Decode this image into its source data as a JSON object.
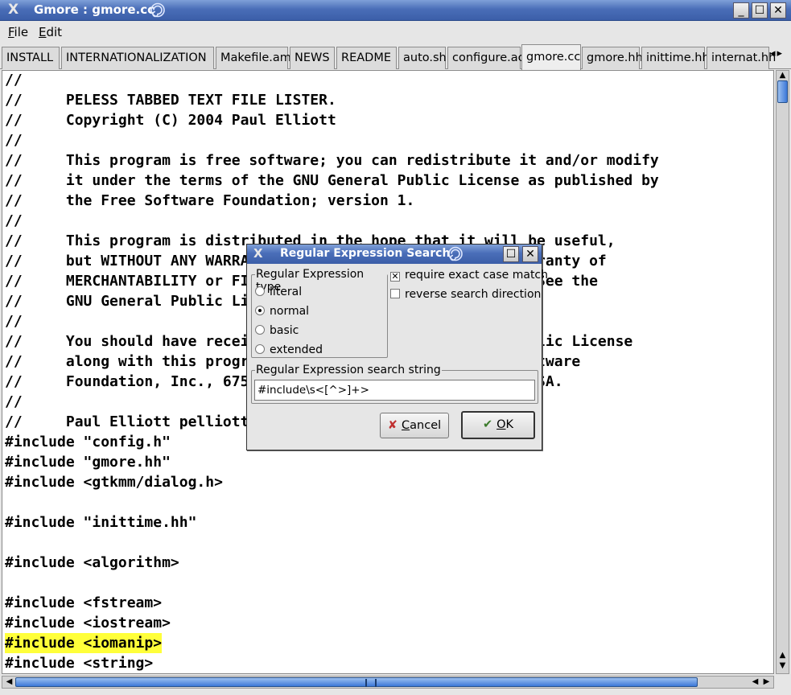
{
  "window": {
    "title": "Gmore : gmore.cc",
    "close_glyph": "✕",
    "restore_glyph": "☐",
    "minimize_glyph": "_"
  },
  "menu": [
    {
      "label": "File",
      "mnemonic": "F",
      "rest": "ile"
    },
    {
      "label": "Edit",
      "mnemonic": "E",
      "rest": "dit"
    }
  ],
  "tabs": [
    {
      "label": "INSTALL"
    },
    {
      "label": "INTERNATIONALIZATION"
    },
    {
      "label": "Makefile.am"
    },
    {
      "label": "NEWS"
    },
    {
      "label": "README"
    },
    {
      "label": "auto.sh"
    },
    {
      "label": "configure.ac"
    },
    {
      "label": "gmore.cc",
      "active": true
    },
    {
      "label": "gmore.hh"
    },
    {
      "label": "inittime.hh"
    },
    {
      "label": "internat.hh"
    }
  ],
  "tab_arrows": "◂▸",
  "editor": {
    "highlight_color": "#ffff3a",
    "lines": [
      "//",
      "//     PELESS TABBED TEXT FILE LISTER.",
      "//     Copyright (C) 2004 Paul Elliott",
      "//",
      "//     This program is free software; you can redistribute it and/or modify",
      "//     it under the terms of the GNU General Public License as published by",
      "//     the Free Software Foundation; version 1.",
      "//",
      "//     This program is distributed in the hope that it will be useful,",
      "//     but WITHOUT ANY WARRANTY; without even the implied warranty of",
      "//     MERCHANTABILITY or FITNESS FOR A PARTICULAR PURPOSE.  See the",
      "//     GNU General Public License for more details.",
      "//",
      "//     You should have received a copy of the GNU General Public License",
      "//     along with this program; if not, write to the Free Software",
      "//     Foundation, Inc., 675 Mass Ave, Cambridge, MA 02139, USA.",
      "//",
      "//     Paul Elliott pelliott@io.com",
      "#include \"config.h\"",
      "#include \"gmore.hh\"",
      "#include <gtkmm/dialog.h>",
      "",
      "#include \"inittime.hh\"",
      "",
      "#include <algorithm>",
      "",
      "#include <fstream>",
      "#include <iostream>",
      "#include <iomanip>",
      "#include <string>"
    ],
    "highlighted_line": 28
  },
  "dialog": {
    "title": "Regular Expression Search",
    "type_group_label": "Regular Expression type",
    "radio_options": [
      {
        "label": "literal",
        "selected": false
      },
      {
        "label": "normal",
        "selected": true
      },
      {
        "label": "basic",
        "selected": false
      },
      {
        "label": "extended",
        "selected": false
      }
    ],
    "checks": [
      {
        "label": "require exact case match",
        "checked": true,
        "mark": "✕"
      },
      {
        "label": "reverse search direction",
        "checked": false,
        "mark": ""
      }
    ],
    "search_group_label": "Regular Expression search string",
    "search_value": "#include\\s<[^>]+>",
    "cancel": {
      "icon": "✘",
      "mnemonic": "C",
      "rest": "ancel"
    },
    "ok": {
      "icon": "✔",
      "mnemonic": "O",
      "rest": "K"
    }
  }
}
